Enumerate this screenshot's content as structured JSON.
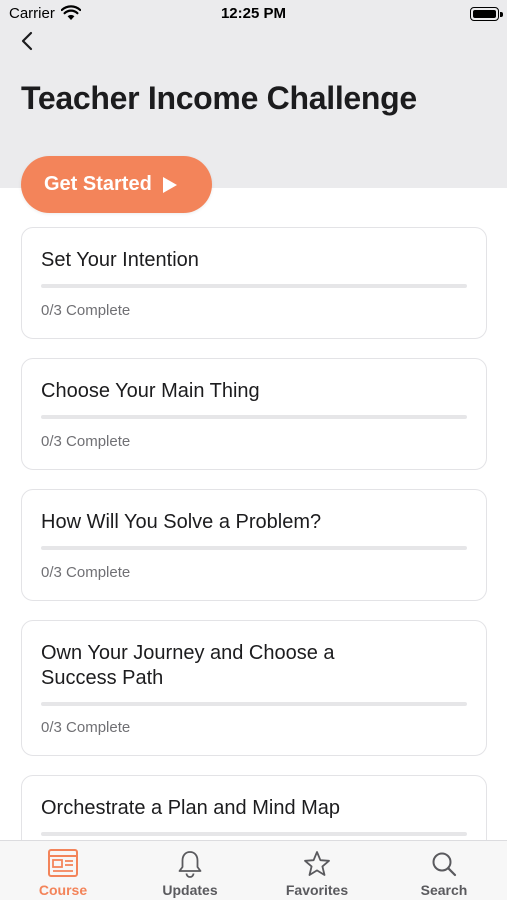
{
  "status_bar": {
    "carrier": "Carrier",
    "time": "12:25 PM",
    "battery_level": 1.0
  },
  "header": {
    "title": "Teacher Income Challenge"
  },
  "get_started": {
    "label": "Get Started"
  },
  "lessons": [
    {
      "title": "Set Your Intention",
      "status": "0/3 Complete",
      "progress": 0
    },
    {
      "title": "Choose Your Main Thing",
      "status": "0/3 Complete",
      "progress": 0
    },
    {
      "title": "How Will You Solve a Problem?",
      "status": "0/3 Complete",
      "progress": 0
    },
    {
      "title": "Own Your Journey and Choose a Success Path",
      "status": "0/3 Complete",
      "progress": 0
    },
    {
      "title": "Orchestrate a Plan and Mind Map",
      "status": "",
      "progress": 0
    }
  ],
  "tabs": [
    {
      "label": "Course",
      "icon": "course-icon",
      "active": true
    },
    {
      "label": "Updates",
      "icon": "bell-icon",
      "active": false
    },
    {
      "label": "Favorites",
      "icon": "star-icon",
      "active": false
    },
    {
      "label": "Search",
      "icon": "search-icon",
      "active": false
    }
  ],
  "colors": {
    "accent": "#f3845a",
    "header_bg": "#ebebed",
    "inactive_tab": "#5a5a5e"
  }
}
